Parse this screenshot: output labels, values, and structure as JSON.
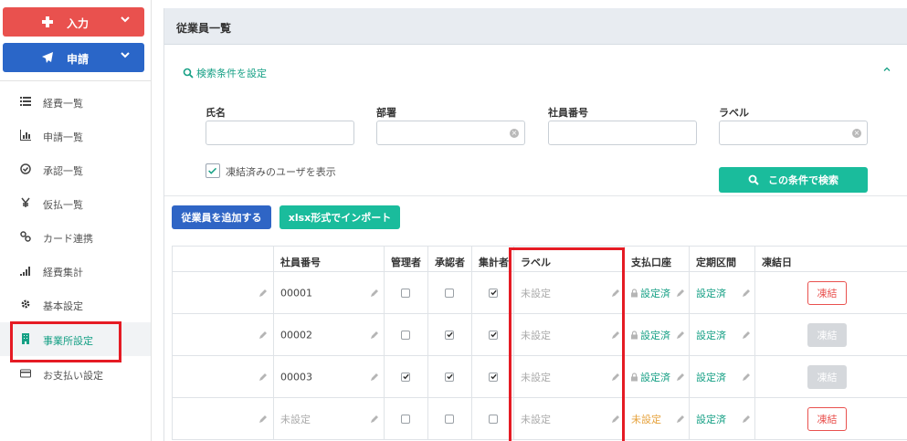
{
  "sidebar": {
    "input_button": "入力",
    "apply_button": "申請",
    "items": [
      {
        "label": "経費一覧",
        "icon": "list-icon"
      },
      {
        "label": "申請一覧",
        "icon": "bar-chart-icon"
      },
      {
        "label": "承認一覧",
        "icon": "check-circle-icon"
      },
      {
        "label": "仮払一覧",
        "icon": "yen-icon"
      },
      {
        "label": "カード連携",
        "icon": "link-icon"
      },
      {
        "label": "経費集計",
        "icon": "signal-icon"
      },
      {
        "label": "基本設定",
        "icon": "gear-icon"
      },
      {
        "label": "事業所設定",
        "icon": "building-icon",
        "active": true
      },
      {
        "label": "お支払い設定",
        "icon": "credit-card-icon"
      }
    ]
  },
  "header": {
    "title": "従業員一覧"
  },
  "search": {
    "toggle_label": "検索条件を設定",
    "fields": {
      "name": {
        "label": "氏名",
        "value": ""
      },
      "department": {
        "label": "部署",
        "value": ""
      },
      "employee_number": {
        "label": "社員番号",
        "value": ""
      },
      "label": {
        "label": "ラベル",
        "value": ""
      }
    },
    "show_frozen_label": "凍結済みのユーザを表示",
    "show_frozen_checked": true,
    "submit_label": "この条件で検索"
  },
  "actions": {
    "add_employee": "従業員を追加する",
    "import_xlsx": "xlsx形式でインポート"
  },
  "table": {
    "columns": [
      "",
      "社員番号",
      "管理者",
      "承認者",
      "集計者",
      "ラベル",
      "支払口座",
      "定期区間",
      "凍結日"
    ],
    "rows": [
      {
        "employee_number": "00001",
        "number_set": true,
        "admin": false,
        "approver": false,
        "aggregator": true,
        "label": "未設定",
        "bank": "設定済",
        "bank_set": true,
        "commute": "設定済",
        "freeze": "凍結",
        "freeze_enabled": true
      },
      {
        "employee_number": "00002",
        "number_set": true,
        "admin": false,
        "approver": true,
        "aggregator": true,
        "label": "未設定",
        "bank": "設定済",
        "bank_set": true,
        "commute": "設定済",
        "freeze": "凍結",
        "freeze_enabled": false
      },
      {
        "employee_number": "00003",
        "number_set": true,
        "admin": true,
        "approver": true,
        "aggregator": true,
        "label": "未設定",
        "bank": "設定済",
        "bank_set": true,
        "commute": "設定済",
        "freeze": "凍結",
        "freeze_enabled": false
      },
      {
        "employee_number": "未設定",
        "number_set": false,
        "admin": false,
        "approver": false,
        "aggregator": false,
        "label": "未設定",
        "bank": "未設定",
        "bank_set": false,
        "commute": "設定済",
        "freeze": "凍結",
        "freeze_enabled": true
      }
    ]
  },
  "colors": {
    "red": "#e9514e",
    "blue": "#2a66c8",
    "teal": "#1abc9c",
    "green_text": "#16a085",
    "orange_text": "#e6a23c",
    "highlight_box": "#e51b24"
  }
}
